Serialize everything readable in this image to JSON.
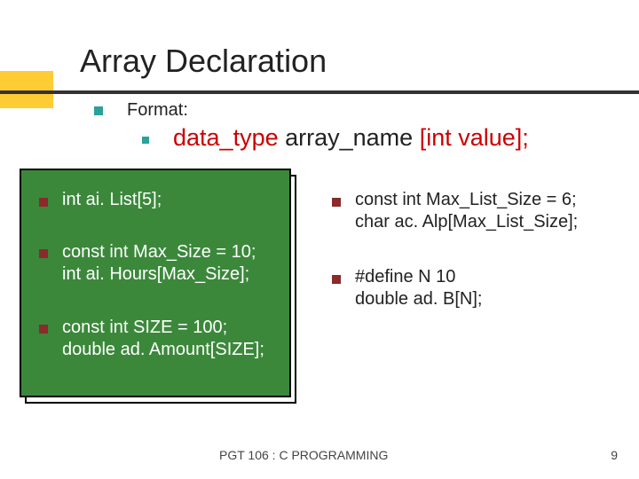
{
  "title": "Array Declaration",
  "format_label": "Format:",
  "format_line": {
    "data_type": "data_type ",
    "array_name": "array_name ",
    "bracket": "[int  value];"
  },
  "left_items": [
    "int ai. List[5];",
    "const int Max_Size = 10;\nint ai. Hours[Max_Size];",
    "const int SIZE = 100;\ndouble ad. Amount[SIZE];"
  ],
  "right_items": [
    "const int Max_List_Size = 6;\nchar ac. Alp[Max_List_Size];",
    "#define N 10\ndouble ad. B[N];"
  ],
  "footer": "PGT 106 : C PROGRAMMING",
  "page": "9"
}
